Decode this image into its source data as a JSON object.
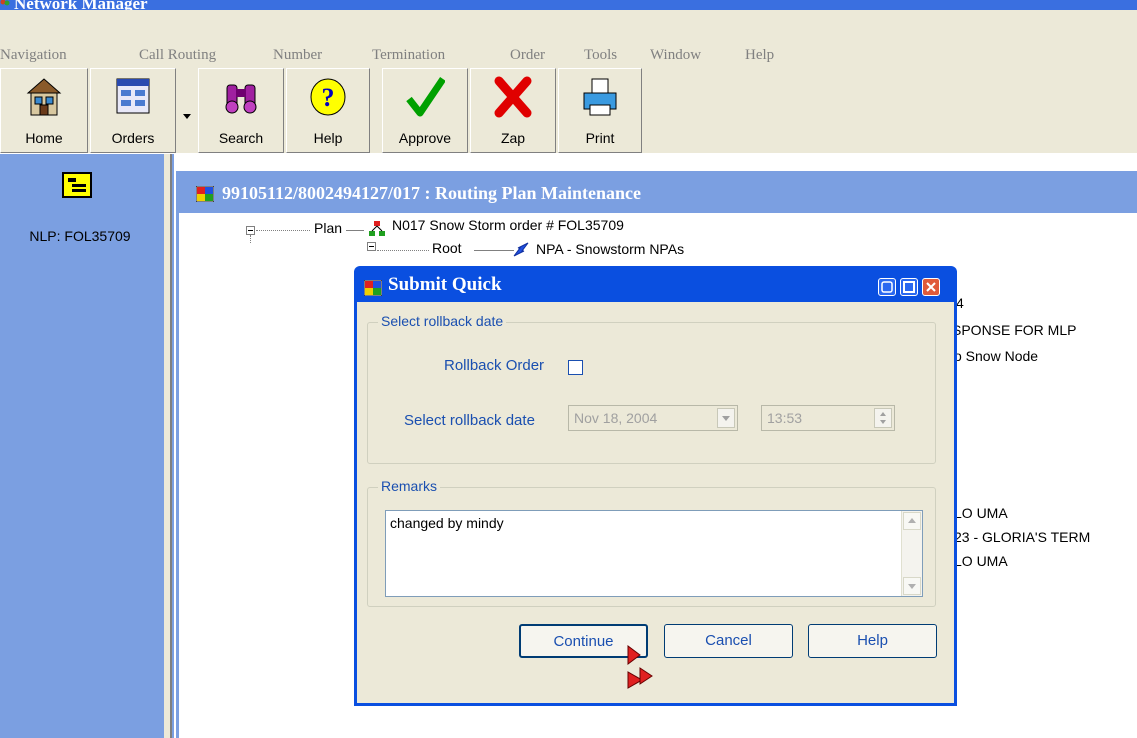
{
  "app": {
    "title": "Network Manager"
  },
  "menu": [
    "Navigation",
    "Call Routing",
    "Number",
    "Termination",
    "Order",
    "Tools",
    "Window",
    "Help"
  ],
  "toolbar": {
    "home": "Home",
    "orders": "Orders",
    "search": "Search",
    "help": "Help",
    "approve": "Approve",
    "zap": "Zap",
    "print": "Print"
  },
  "left_panel": {
    "label": "NLP: FOL35709"
  },
  "mdi": {
    "title": "99105112/8002494127/017 : Routing Plan Maintenance",
    "tree": {
      "plan_label": "Plan",
      "plan_text": "N017  Snow Storm  order # FOL35709",
      "root_label": "Root",
      "root_text": "NPA - Snowstorm NPAs"
    },
    "partial_lines": [
      "4",
      "SPONSE FOR MLP",
      "o Snow Node",
      "LO UMA",
      "23 - GLORIA'S TERM",
      "LO UMA"
    ]
  },
  "dialog": {
    "title": "Submit Quick",
    "rollback_group": "Select rollback date",
    "rollback_order_label": "Rollback Order",
    "rollback_order_checked": false,
    "select_date_label": "Select rollback date",
    "date_value": "Nov 18, 2004",
    "time_value": "13:53",
    "remarks_group": "Remarks",
    "remarks_text": "changed by mindy",
    "continue": "Continue",
    "cancel": "Cancel",
    "help": "Help"
  }
}
